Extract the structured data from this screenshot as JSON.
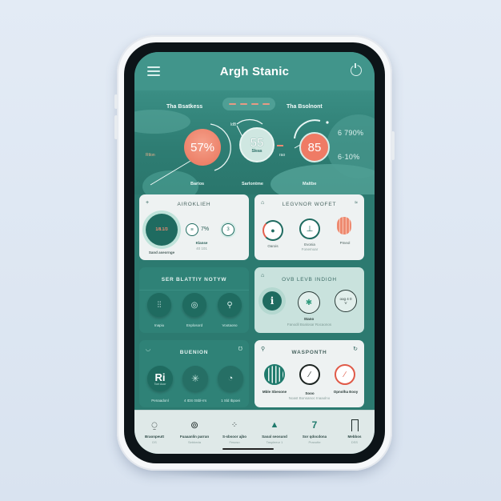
{
  "app": {
    "title": "Argh Stanic"
  },
  "header": {
    "menu_icon": "hamburger-menu-icon",
    "power_icon": "power-icon"
  },
  "hero": {
    "left_label": "Tha Bsatkess",
    "right_label": "Tha Bsolnont",
    "pill_dashes": 4,
    "side_note": "Rtlon",
    "gauges": [
      {
        "value": "57%",
        "caption": "Barlos",
        "color": "#ef8a72"
      },
      {
        "value": "55",
        "unit": "Sleas",
        "caption": "Sarlontme",
        "color": "#c8e4de",
        "tag": "ldB"
      },
      {
        "value": "85",
        "caption": "Maltbe",
        "color": "#f07a64",
        "tag": "rao"
      }
    ],
    "stats": [
      "6 790%",
      "6·10%"
    ]
  },
  "cards": {
    "card1": {
      "title": "AIROKLIEH",
      "corner_icon": "plus-icon",
      "main_value": "1/8.1/3",
      "main_caption": "Sand aseornge",
      "mid_value": "7%",
      "mid_label": "Klanse",
      "mid_sub": "40 101",
      "small_value": "3"
    },
    "card2": {
      "title": "LEGVNOR WOFET",
      "left_icon": "bell-icon",
      "right_icon": "wifi-icon",
      "items": [
        {
          "label": "Oarois",
          "icon": "drop-gauge-icon"
        },
        {
          "label": "Evonia",
          "sub": "Fonemoar",
          "icon": "thermometer-dial-icon"
        },
        {
          "label": "Pmeol",
          "icon": "heater-dial-icon"
        }
      ]
    },
    "card3": {
      "title": "SER BLATTIY NOTYW",
      "items": [
        {
          "label": "Inapiu",
          "icon": "sliders-icon"
        },
        {
          "label": "Enplosord",
          "icon": "sensor-icon"
        },
        {
          "label": "Vootaono",
          "icon": "key-icon"
        }
      ]
    },
    "card4": {
      "title": "OVB LEVB INDIOH",
      "corner_icon": "home-icon",
      "info_icon": "info-icon",
      "mid_label": "Stano",
      "sub": "Fanodil Boalosar Rocaonos",
      "right_text": "oog 4 0 V"
    },
    "card5": {
      "title": "BUENION",
      "left_icon": "moon-icon",
      "right_icon": "leaf-icon",
      "items": [
        {
          "big": "Ri",
          "small": "Tont Aoor",
          "label": "Penaadonl"
        },
        {
          "label": "4 IDS 0Sbl-rrs",
          "icon": "sun-burst-icon"
        },
        {
          "label": "1 Sld Ibpoei",
          "icon": "bomb-icon"
        }
      ]
    },
    "card6": {
      "title": "WASPONTH",
      "left_icon": "search-icon",
      "right_icon": "refresh-icon",
      "items": [
        {
          "label": "Mble Sbesone",
          "icon": "radiator-icon"
        },
        {
          "label": "Sooo",
          "icon": "dial-icon"
        },
        {
          "label": "Opnolha Eooy",
          "icon": "red-dial-icon"
        }
      ],
      "sub": "Noast Bonsanoc Inaaolno"
    }
  },
  "bottom_nav": [
    {
      "label": "Braonpeutt",
      "sub": "DS",
      "icon": "location-pin-icon"
    },
    {
      "label": "Fuaaanlin parran",
      "sub": "Sebbeda",
      "icon": "camera-icon"
    },
    {
      "label": "S-sbsoor ajbo",
      "sub": "Fesoso",
      "icon": "sparkle-chart-icon"
    },
    {
      "label": "Saoal seosund",
      "sub": "Taspleeur 1",
      "icon": "leaf-hat-icon"
    },
    {
      "label": "Sor qdocdona",
      "sub": "Pranotte",
      "icon": "number-seven-icon",
      "glyph": "7"
    },
    {
      "label": "Mebbos",
      "sub": "DSS",
      "icon": "door-icon"
    }
  ],
  "colors": {
    "brand": "#41958b",
    "accent_coral": "#ef8a72",
    "dark_teal": "#1f6b60",
    "card_light": "#eef2f2",
    "card_mint": "#c9e2dd",
    "card_teal": "#2f8277"
  }
}
